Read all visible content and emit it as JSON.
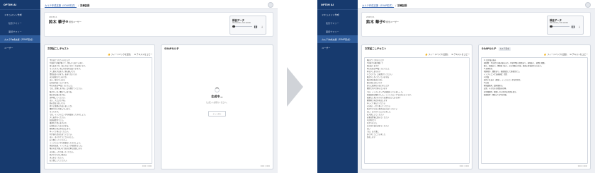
{
  "left": {
    "sidebar": {
      "brand": "OPTiM AI",
      "items": [
        "ドキュメント作成",
        "陰影サマリー",
        "面接サマリー",
        "カルテ作成支援（SOAP形式）",
        "ユーザー"
      ]
    },
    "breadcrumb": {
      "link": "カルテ作成支援（SOAP形式）",
      "sep": "/",
      "current": "診療記録"
    },
    "patient": {
      "id": "2023/11",
      "name": "鈴木 華子",
      "doctor": "担当ユーザー"
    },
    "recording": {
      "title": "録音データ",
      "time": "00:00:00 / 00:19:06",
      "play_icon": "pause-icon",
      "download_icon": "download-icon"
    },
    "transcript": {
      "title": "文字起こしテキスト",
      "feedback_label": "フィードバックを送信",
      "copy_label": "テキストをコピー",
      "footer": "0000 / 0000",
      "lines": [
        "今日はどうなさいましたか",
        "3日前から喉が痛くて、熱も少し出ています。",
        "咳も出ますか。夜になるとひどくなる感じです。",
        "そうですか。他に何か症状はありますか。",
        "少し鼻水が出ます。頭も痛いです。",
        "食欲はありますか。あまりないです。",
        "水分は取れていますか。",
        "はい、取れています。",
        "お熱は何度くらいですか。",
        "昨日の夜は38度くらいでした。",
        "では、診察しますね。口を開けてください。",
        "喉が少し赤く腫れていますね。",
        "胸の音も聴きますね。",
        "深呼吸してください。",
        "はい、大丈夫ですね。",
        "肺の音はきれいです。",
        "周りに風邪の方はいましたか。",
        "職場で何人か休んでいます。",
        "そうですか。",
        "では、インフルエンザの検査をしてみましょう。",
        "少しお待ちください。",
        "結果は陰性でした。",
        "風邪だと思いますので、",
        "お薬を出しておきますね。",
        "解熱剤と咳止めを出します。",
        "ゆっくり休んでください。",
        "何かあればまた来てください。",
        "はい、ありがとうございました。",
        "お大事にしてください。",
        "インフルエンザの検査をしてみましょう。",
        "検査の結果、インフルエンザは陰性でした。",
        "喉の炎症が強いので抗炎症剤も追加します。",
        "水分をしっかり取ってください。",
        "熱が下がらない場合は",
        "また来てください。",
        "お大事にしてください。"
      ]
    },
    "soap": {
      "title": "SOAPカルテ",
      "loading_title": "生成中...",
      "loading_sub": "しばらくお待ちください。",
      "loading_button": "キャンセル",
      "footer": "0000 / 0000"
    }
  },
  "right": {
    "sidebar": {
      "brand": "OPTiM AI",
      "items": [
        "ドキュメント作成",
        "陰影サマリー",
        "面接サマリー",
        "カルテ作成支援（SOAP形式）",
        "ユーザー"
      ]
    },
    "breadcrumb": {
      "link": "カルテ作成支援（SOAP形式）",
      "sep": "/",
      "current": "診療記録"
    },
    "patient": {
      "id": "2023/11",
      "name": "鈴木 華子",
      "doctor": "担当ユーザー"
    },
    "recording": {
      "title": "録音データ",
      "time": "00:00:00 / 00:19:06",
      "play_icon": "pause-icon",
      "download_icon": "download-icon"
    },
    "transcript": {
      "title": "文字起こしテキスト",
      "feedback_label": "フィードバックを送信",
      "copy_label": "テキストをコピー",
      "footer": "0000 / 0000",
      "lines": [
        "喉はどうされましたか",
        "3日前から喉が痛くて",
        "熱はありますか",
        "昨日の夜は38度くらいでした",
        "咳も少しあります",
        "そうですか。口を開けてください",
        "喉が少し赤くなっていますね",
        "胸の音を聴きますね",
        "肺の音はきれいです",
        "周りに風邪の方はいましたか",
        "職場で何人か休んでいます",
        "では、インフルエンザの検査をしてみましょう。",
        "検査結果は陰性でした。インフルエンザではないようです。",
        "風邪だと思いますのでお薬を出しておきます",
        "解熱剤と咳止めを出します",
        "ゆっくり休んでください",
        "水分をしっかり取ってください",
        "熱が下がらない場合はまた来てください",
        "はい、ありがとうございました",
        "お大事にしてください",
        "お薬は食後に飲んでください",
        "1日3回です",
        "わかりました",
        "また何かあれば来てください",
        "はい",
        "では、お大事に",
        "ありがとうございました",
        "失礼します"
      ]
    },
    "soap": {
      "title": "SOAPカルテ",
      "tab": "カルテ形式",
      "feedback_label": "フィードバックを送信",
      "copy_label": "テキストをコピー",
      "footer": "0000 / 0000",
      "lines": [
        "S:主訴 喉の痛み",
        "現病歴：3日前から喉の痛みあり。昨夜38度の発熱あり。咳嗽あり、夜間に増悪。",
        "鼻汁、頭痛あり。食欲低下あり。水分摂取は可能。周囲に感冒症状の方あり。",
        "O:身体所見",
        "咽頭発赤、腫脹あり。胸部聴診にて肺雑音なし。",
        "インフルエンザ迅速検査：陰性",
        "A:評価",
        "急性上気道炎（感冒）。インフルエンザは否定的。",
        "P:計画",
        "解熱鎮痛剤、鎮咳薬処方。",
        "安静、十分な水分摂取を指導。",
        "症状増悪時、解熱しない場合は再診を指示。",
        "服薬指導：食後に1日3回内服。"
      ]
    }
  },
  "colors": {
    "sidebar": "#173a6e",
    "sidebar_active": "#2e5b9a",
    "link": "#2d5ca8",
    "background": "#eef0f4"
  }
}
